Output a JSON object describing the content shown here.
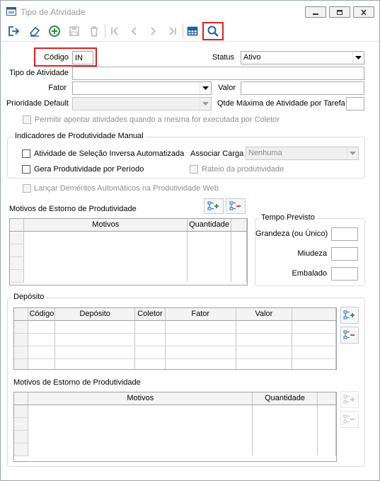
{
  "window": {
    "title": "Tipo de Atividade",
    "controls": [
      "minimize",
      "maximize",
      "close"
    ]
  },
  "toolbar": {
    "buttons": [
      {
        "icon": "exit-icon",
        "enabled": true
      },
      {
        "icon": "eraser-icon",
        "enabled": true
      },
      {
        "icon": "add-circle-icon",
        "enabled": true
      },
      {
        "icon": "save-icon",
        "enabled": false
      },
      {
        "icon": "trash-icon",
        "enabled": false
      },
      {
        "icon": "first-record-icon",
        "enabled": false
      },
      {
        "icon": "previous-record-icon",
        "enabled": false
      },
      {
        "icon": "next-record-icon",
        "enabled": false
      },
      {
        "icon": "last-record-icon",
        "enabled": false
      },
      {
        "icon": "grid-view-icon",
        "enabled": true
      },
      {
        "icon": "search-icon",
        "enabled": true,
        "highlighted": true
      }
    ]
  },
  "form": {
    "codigo_label": "Código",
    "codigo_value": "IN",
    "status_label": "Status",
    "status_value": "Ativo",
    "tipo_label": "Tipo de Atividade",
    "tipo_value": "",
    "fator_label": "Fator",
    "fator_value": "",
    "valor_label": "Valor",
    "valor_value": "",
    "prioridade_label": "Prioridade Default",
    "prioridade_value": "",
    "qtde_label": "Qtde Máxima de Atividade por Tarefa",
    "qtde_value": "",
    "permitir_label": "Permitir apontar atividades quando a mesma for executada por Coletor"
  },
  "indicadores": {
    "title": "Indicadores de Produtividade Manual",
    "selecao_label": "Atividade de Seleção Inversa Automatizada",
    "associar_label": "Associar Carga",
    "associar_value": "Nenhuma",
    "gera_label": "Gera Produtividade por Período",
    "rateio_label": "Rateio da produtividade"
  },
  "lancar_label": "Lançar Deméritos Automáticos na Produtividade Web",
  "motivos1": {
    "title": "Motivos de Estorno de Produtividade",
    "columns": [
      "Motivos",
      "Quantidade"
    ]
  },
  "tempo": {
    "title": "Tempo Previsto",
    "grandeza_label": "Grandeza (ou Único)",
    "miudeza_label": "Miudeza",
    "embalado_label": "Embalado"
  },
  "deposito": {
    "title": "Depósito",
    "columns": [
      "Código",
      "Depósito",
      "Coletor",
      "Fator",
      "Valor"
    ],
    "motivos_title": "Motivos de Estorno de Produtividade",
    "motivos_columns": [
      "Motivos",
      "Quantidade"
    ]
  },
  "colors": {
    "highlight": "#e02020",
    "accent_green": "#2e8b3a",
    "accent_blue": "#1c6fb8",
    "accent_red": "#d9342b"
  }
}
